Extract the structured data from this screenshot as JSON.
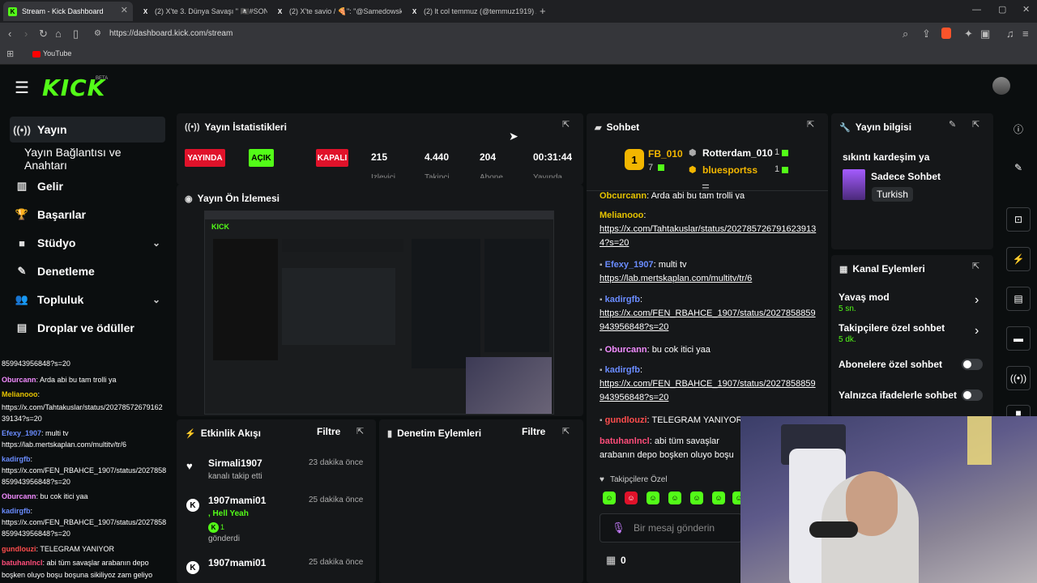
{
  "browser": {
    "tabs": [
      {
        "label": "Stream - Kick Dashboard",
        "favicon": "K"
      },
      {
        "label": "(2) X'te 3. Dünya Savaşı \" 🏴‍☠️#SONDA",
        "favicon": "X"
      },
      {
        "label": "(2) X'te savio / 🍕\": \"@Samedowski",
        "favicon": "X"
      },
      {
        "label": "(2) lt col temmuz (@temmuz1919) / X",
        "favicon": "X"
      }
    ],
    "url": "https://dashboard.kick.com/stream",
    "bookmark": "YouTube"
  },
  "logo": {
    "text": "KICK",
    "badge": "BETA"
  },
  "sidebar": {
    "items": [
      {
        "label": "Yayın",
        "icon": "broadcast-icon"
      },
      {
        "label": "Yayın Bağlantısı ve Anahtarı",
        "icon": ""
      },
      {
        "label": "Gelir",
        "icon": "bar-chart-icon"
      },
      {
        "label": "Başarılar",
        "icon": "trophy-icon"
      },
      {
        "label": "Stüdyo",
        "icon": "video-icon"
      },
      {
        "label": "Denetleme",
        "icon": "wrench-icon"
      },
      {
        "label": "Topluluk",
        "icon": "users-icon"
      },
      {
        "label": "Droplar ve ödüller",
        "icon": "gift-icon"
      }
    ]
  },
  "stats_panel": {
    "title": "Yayın İstatistikleri",
    "live_badge": "YAYINDA",
    "open_badge": "AÇIK",
    "closed_badge": "KAPALI",
    "stats": [
      {
        "value": "215",
        "label": "İzleyici"
      },
      {
        "value": "4.440",
        "label": "Takipçi"
      },
      {
        "value": "204",
        "label": "Abone"
      },
      {
        "value": "00:31:44",
        "label": "Yayında"
      }
    ]
  },
  "preview_panel": {
    "title": "Yayın Ön İzlemesi"
  },
  "activity_panel": {
    "title": "Etkinlik Akışı",
    "filter": "Filtre",
    "events": [
      {
        "user": "Sirmali1907",
        "time": "23 dakika önce",
        "detail": "kanalı takip etti"
      },
      {
        "user": "1907mami01",
        "time": "25 dakika önce",
        "detail": ", Hell Yeah",
        "count": "1",
        "extra": "gönderdi"
      },
      {
        "user": "1907mami01",
        "time": "25 dakika önce"
      }
    ]
  },
  "moderation_panel": {
    "title": "Denetim Eylemleri",
    "filter": "Filtre"
  },
  "chat_panel": {
    "title": "Sohbet",
    "gifters": [
      {
        "rank": "1",
        "name": "FB_010",
        "count": "7"
      },
      {
        "name": "Rotterdam_010",
        "count": "1"
      },
      {
        "name": "bluesportss",
        "count": "1"
      }
    ],
    "messages": [
      {
        "user": "Obcurcann",
        "text": "Arda abi bu tam trolli ya",
        "color": "#e6c300"
      },
      {
        "user": "Melianooo",
        "text": "https://x.com/Tahtakuslar/status/2027857267916239134?s=20",
        "color": "#e6c300"
      },
      {
        "user": "Efexy_1907",
        "text": "multi tv",
        "link": "https://lab.mertskaplan.com/multitv/tr/6",
        "color": "#6a8cff"
      },
      {
        "user": "kadirgfb",
        "text": "https://x.com/FEN_RBAHCE_1907/status/2027858859943956848?s=20",
        "color": "#6a8cff"
      },
      {
        "user": "Oburcann",
        "text": "bu cok itici yaa",
        "color": "#f28cff"
      },
      {
        "user": "kadirgfb",
        "text": "https://x.com/FEN_RBAHCE_1907/status/2027858859943956848?s=20",
        "color": "#6a8cff"
      },
      {
        "user": "gundlouzi",
        "text": "TELEGRAM YANIYOR",
        "color": "#ff4d4d"
      },
      {
        "user": "batuhanlncl",
        "text": "abi tüm savaşlar arabanın depo boşken oluyo boşu boşuna sikiliyoz",
        "color": "#ff4d7a"
      }
    ],
    "followers_only": "Takipçilere Özel",
    "input_placeholder": "Bir mesaj gönderin",
    "gift_count": "0"
  },
  "stream_info_panel": {
    "title": "Yayın bilgisi",
    "stream_title": "sıkıntı kardeşim ya",
    "category": "Sadece Sohbet",
    "tag": "Turkish"
  },
  "channel_actions_panel": {
    "title": "Kanal Eylemleri",
    "actions": [
      {
        "label": "Yavaş mod",
        "value": "5 sn."
      },
      {
        "label": "Takipçilere özel sohbet",
        "value": "5 dk."
      },
      {
        "label": "Abonelere özel sohbet"
      },
      {
        "label": "Yalnızca ifadelerle sohbet"
      }
    ]
  },
  "overlay_chat": {
    "lines": [
      {
        "user": "",
        "text": "859943956848?s=20"
      },
      {
        "user": "Oburcann",
        "text": ": Arda abi bu tam trolli ya",
        "color": "#f28cff"
      },
      {
        "user": "Melianooo",
        "text": ":",
        "color": "#e6c300"
      },
      {
        "user": "",
        "text": "https://x.com/Tahtakuslar/status/20278572679162"
      },
      {
        "user": "",
        "text": "39134?s=20"
      },
      {
        "user": "Efexy_1907",
        "text": ": multi tv",
        "color": "#6a8cff"
      },
      {
        "user": "",
        "text": "https://lab.mertskaplan.com/multitv/tr/6"
      },
      {
        "user": "kadirgfb",
        "text": ":",
        "color": "#6a8cff"
      },
      {
        "user": "",
        "text": "https://x.com/FEN_RBAHCE_1907/status/2027858"
      },
      {
        "user": "",
        "text": "859943956848?s=20"
      },
      {
        "user": "Oburcann",
        "text": ": bu cok itici yaa",
        "color": "#f28cff"
      },
      {
        "user": "kadirgfb",
        "text": ":",
        "color": "#6a8cff"
      },
      {
        "user": "",
        "text": "https://x.com/FEN_RBAHCE_1907/status/2027858"
      },
      {
        "user": "",
        "text": "859943956848?s=20"
      },
      {
        "user": "gundlouzi",
        "text": ": TELEGRAM YANIYOR",
        "color": "#ff4d4d"
      },
      {
        "user": "batuhanlncl",
        "text": ": abi tüm savaşlar arabanın depo",
        "color": "#ff4d7a"
      },
      {
        "user": "",
        "text": "boşken oluyo boşu boşuna sikiliyoz zam geliyo"
      }
    ]
  },
  "colors": {
    "brand": "#53fc18",
    "live": "#e0122a",
    "panel": "#151719",
    "bg": "#0b0e0f"
  }
}
